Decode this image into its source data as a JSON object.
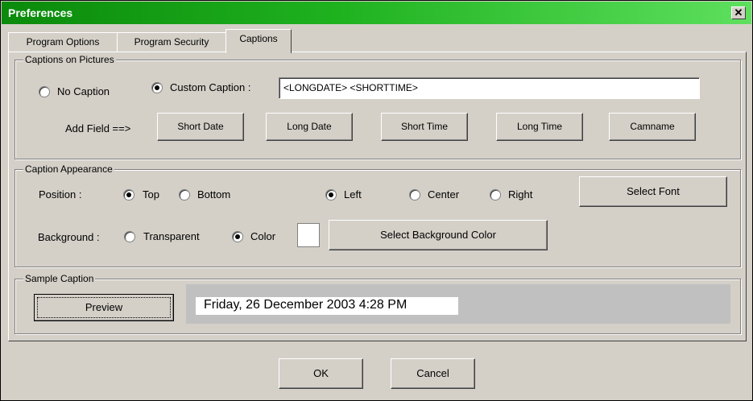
{
  "window": {
    "title": "Preferences",
    "close_glyph": "✕"
  },
  "tabs": [
    {
      "label": "Program Options"
    },
    {
      "label": "Program Security"
    },
    {
      "label": "Captions"
    }
  ],
  "captions_on_pictures": {
    "group_label": "Captions on Pictures",
    "no_caption_label": "No Caption",
    "custom_caption_label": "Custom Caption :",
    "custom_caption_value": "<LONGDATE> <SHORTTIME>",
    "selected": "custom",
    "add_field_label": "Add Field ==>",
    "buttons": [
      "Short Date",
      "Long Date",
      "Short Time",
      "Long Time",
      "Camname"
    ]
  },
  "caption_appearance": {
    "group_label": "Caption Appearance",
    "position_label": "Position :",
    "top_label": "Top",
    "bottom_label": "Bottom",
    "left_label": "Left",
    "center_label": "Center",
    "right_label": "Right",
    "select_font_label": "Select Font",
    "background_label": "Background :",
    "transparent_label": "Transparent",
    "color_label": "Color",
    "swatch_color": "#ffffff",
    "select_bg_label": "Select Background Color",
    "vertical_selected": "top",
    "horizontal_selected": "left",
    "background_selected": "color"
  },
  "sample_caption": {
    "group_label": "Sample Caption",
    "preview_label": "Preview",
    "sample_text": "Friday, 26 December 2003 4:28 PM"
  },
  "footer": {
    "ok_label": "OK",
    "cancel_label": "Cancel"
  }
}
